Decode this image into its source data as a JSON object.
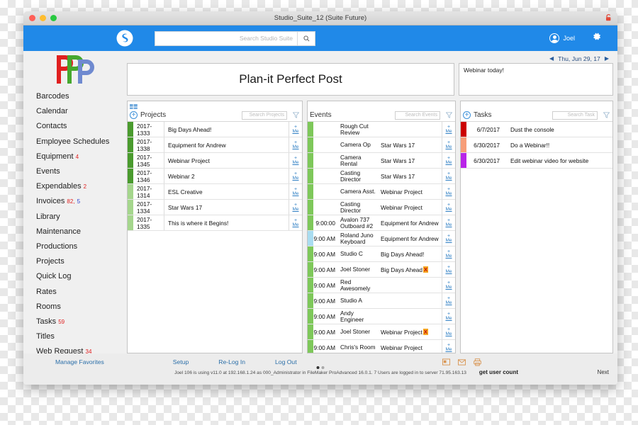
{
  "window": {
    "title": "Studio_Suite_12 (Suite Future)",
    "lock_icon": "lock-icon"
  },
  "appbar": {
    "brand_icon": "studio-suite-logo",
    "search_placeholder": "Search Studio Suite",
    "search_value": "",
    "search_icon": "search-icon",
    "user_name": "Joel",
    "avatar_icon": "user-avatar-icon",
    "gear_icon": "gear-icon"
  },
  "sidebar": {
    "logo_alt": "plan-it-perfect-post-logo",
    "items": [
      {
        "label": "Barcodes",
        "badge": "",
        "badge2": ""
      },
      {
        "label": "Calendar",
        "badge": "",
        "badge2": ""
      },
      {
        "label": "Contacts",
        "badge": "",
        "badge2": ""
      },
      {
        "label": "Employee Schedules",
        "badge": "",
        "badge2": ""
      },
      {
        "label": "Equipment",
        "badge": "4",
        "badge2": ""
      },
      {
        "label": "Events",
        "badge": "",
        "badge2": ""
      },
      {
        "label": "Expendables",
        "badge": "2",
        "badge2": ""
      },
      {
        "label": "Invoices",
        "badge": "82,",
        "badge2": "5"
      },
      {
        "label": "Library",
        "badge": "",
        "badge2": ""
      },
      {
        "label": "Maintenance",
        "badge": "",
        "badge2": ""
      },
      {
        "label": "Productions",
        "badge": "",
        "badge2": ""
      },
      {
        "label": "Projects",
        "badge": "",
        "badge2": ""
      },
      {
        "label": "Quick Log",
        "badge": "",
        "badge2": ""
      },
      {
        "label": "Rates",
        "badge": "",
        "badge2": ""
      },
      {
        "label": "Rooms",
        "badge": "",
        "badge2": ""
      },
      {
        "label": "Tasks",
        "badge": "59",
        "badge2": ""
      },
      {
        "label": "Titles",
        "badge": "",
        "badge2": ""
      },
      {
        "label": "Web Request",
        "badge": "34",
        "badge2": ""
      }
    ]
  },
  "datebar": {
    "prev_icon": "triangle-left-icon",
    "date": "Thu, Jun 29, 17",
    "next_icon": "triangle-right-icon"
  },
  "title_card": {
    "heading": "Plan-it Perfect Post"
  },
  "note_card": {
    "text": "Webinar today!"
  },
  "projects": {
    "grid_icon": "grid-layout-icon",
    "add_icon": "plus-circle-icon",
    "title": "Projects",
    "search_placeholder": "Search Projects",
    "search_value": "",
    "filter_icon": "filter-funnel-icon",
    "me_plus": "+",
    "me_label": "Me",
    "rows": [
      {
        "color": "#4a9b2e",
        "id": "2017-1333",
        "name": "Big Days Ahead!"
      },
      {
        "color": "#4a9b2e",
        "id": "2017-1338",
        "name": "Equipment for Andrew"
      },
      {
        "color": "#4a9b2e",
        "id": "2017-1345",
        "name": "Webinar Project"
      },
      {
        "color": "#4a9b2e",
        "id": "2017-1346",
        "name": "Webinar 2"
      },
      {
        "color": "#a5d68d",
        "id": "2017-1314",
        "name": "ESL Creative"
      },
      {
        "color": "#a5d68d",
        "id": "2017-1334",
        "name": "Star Wars 17"
      },
      {
        "color": "#a5d68d",
        "id": "2017-1335",
        "name": "This is where it Begins!"
      }
    ]
  },
  "events": {
    "title": "Events",
    "search_placeholder": "Search Events",
    "search_value": "",
    "filter_icon": "filter-funnel-icon",
    "me_plus": "+",
    "me_label": "Me",
    "rows": [
      {
        "color": "#7ec85a",
        "time": "",
        "name": "Rough Cut Review",
        "project": "",
        "flag": ""
      },
      {
        "color": "#7ec85a",
        "time": "",
        "name": "Camera Op",
        "project": "Star Wars 17",
        "flag": ""
      },
      {
        "color": "#7ec85a",
        "time": "",
        "name": "Camera Rental",
        "project": "Star Wars 17",
        "flag": ""
      },
      {
        "color": "#7ec85a",
        "time": "",
        "name": "Casting Director",
        "project": "Star Wars 17",
        "flag": ""
      },
      {
        "color": "#7ec85a",
        "time": "",
        "name": "Camera Asst.",
        "project": "Webinar Project",
        "flag": ""
      },
      {
        "color": "#7ec85a",
        "time": "",
        "name": "Casting Director",
        "project": "Webinar Project",
        "flag": ""
      },
      {
        "color": "#7ec85a",
        "time": "9:00:00",
        "name": "Avalon 737 Outboard #2",
        "project": "Equipment for Andrew",
        "flag": ""
      },
      {
        "color": "#a9dcf0",
        "time": "9:00 AM",
        "name": "Roland Juno Keyboard",
        "project": "Equipment for Andrew",
        "flag": ""
      },
      {
        "color": "#7ec85a",
        "time": "9:00 AM",
        "name": "Studio C",
        "project": "Big Days Ahead!",
        "flag": ""
      },
      {
        "color": "#7ec85a",
        "time": "9:00 AM",
        "name": "Joel Stoner",
        "project": "Big Days Ahead",
        "flag": "X"
      },
      {
        "color": "#7ec85a",
        "time": "9:00 AM",
        "name": "Red Awesomely",
        "project": "",
        "flag": ""
      },
      {
        "color": "#7ec85a",
        "time": "9:00 AM",
        "name": "Studio A",
        "project": "",
        "flag": ""
      },
      {
        "color": "#7ec85a",
        "time": "9:00 AM",
        "name": "Andy Engineer",
        "project": "",
        "flag": ""
      },
      {
        "color": "#7ec85a",
        "time": "9:00 AM",
        "name": "Joel Stoner",
        "project": "Webinar Project",
        "flag": "X"
      },
      {
        "color": "#7ec85a",
        "time": "9:00 AM",
        "name": "Chris's Room",
        "project": "Webinar Project",
        "flag": ""
      }
    ]
  },
  "tasks": {
    "add_icon": "plus-circle-icon",
    "title": "Tasks",
    "search_placeholder": "Search Task",
    "search_value": "",
    "filter_icon": "filter-funnel-icon",
    "rows": [
      {
        "color": "#cc0000",
        "date": "6/7/2017",
        "name": "Dust the console"
      },
      {
        "color": "#f79d78",
        "date": "6/30/2017",
        "name": "Do a Webinar!!"
      },
      {
        "color": "#b924e8",
        "date": "6/30/2017",
        "name": "Edit webinar video for website"
      }
    ]
  },
  "footer": {
    "manage_favorites": "Manage Favorites",
    "setup": "Setup",
    "relog": "Re-Log In",
    "logout": "Log Out",
    "icon_media": "media-icon",
    "icon_mail": "envelope-icon",
    "icon_print": "printer-icon",
    "status": "Joel 106 is using v11.0 at 192.168.1.24 as 000_Administrator in FileMaker ProAdvanced 16.0.1.  7 Users are logged in to server 71.95.163.13",
    "get_user_count": "get user count",
    "next": "Next"
  },
  "colors": {
    "accent_blue": "#2089e8",
    "link_blue": "#2a6ea8",
    "badge_red": "#e02020",
    "badge_blue": "#2a3ed0"
  }
}
